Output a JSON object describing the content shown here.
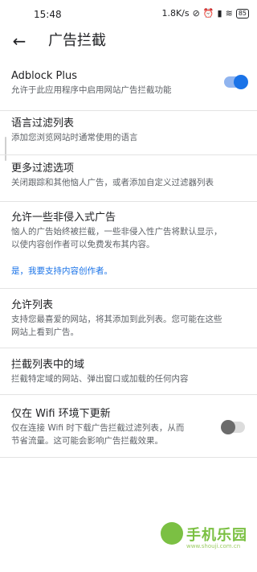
{
  "status_bar": {
    "time": "15:48",
    "speed": "1.8K/s",
    "battery": "85"
  },
  "app_bar": {
    "title": "广告拦截"
  },
  "settings": [
    {
      "title": "Adblock Plus",
      "description": "允许于此应用程序中启用网站广告拦截功能",
      "toggle": true
    },
    {
      "title": "语言过滤列表",
      "description": "添加您浏览网站时通常使用的语言"
    },
    {
      "title": "更多过滤选项",
      "description": "关闭跟踪和其他恼人广告，或者添加自定义过滤器列表"
    },
    {
      "title": "允许一些非侵入式广告",
      "description_lines": [
        "恼人的广告始终被拦截，一些非侵入性广告将默认显示，",
        "以使内容创作者可以免费发布其内容。"
      ],
      "link": "是，我要支持内容创作者。"
    },
    {
      "title": "允许列表",
      "description_lines": [
        "支持您最喜爱的网站，将其添加到此列表。您可能在这些",
        "网站上看到广告。"
      ]
    },
    {
      "title": "拦截列表中的域",
      "description": "拦截特定域的网站、弹出窗口或加载的任何内容"
    },
    {
      "title": "仅在 Wifi 环境下更新",
      "description_lines": [
        "仅在连接 Wifi 时下载广告拦截过滤列表，从而",
        "节省流量。这可能会影响广告拦截效果。"
      ],
      "toggle": false
    }
  ],
  "watermark": {
    "text": "手机乐园",
    "sub": "www.shouji.com.cn"
  },
  "colors": {
    "accent": "#1a73e8",
    "watermark": "#7bc043"
  }
}
